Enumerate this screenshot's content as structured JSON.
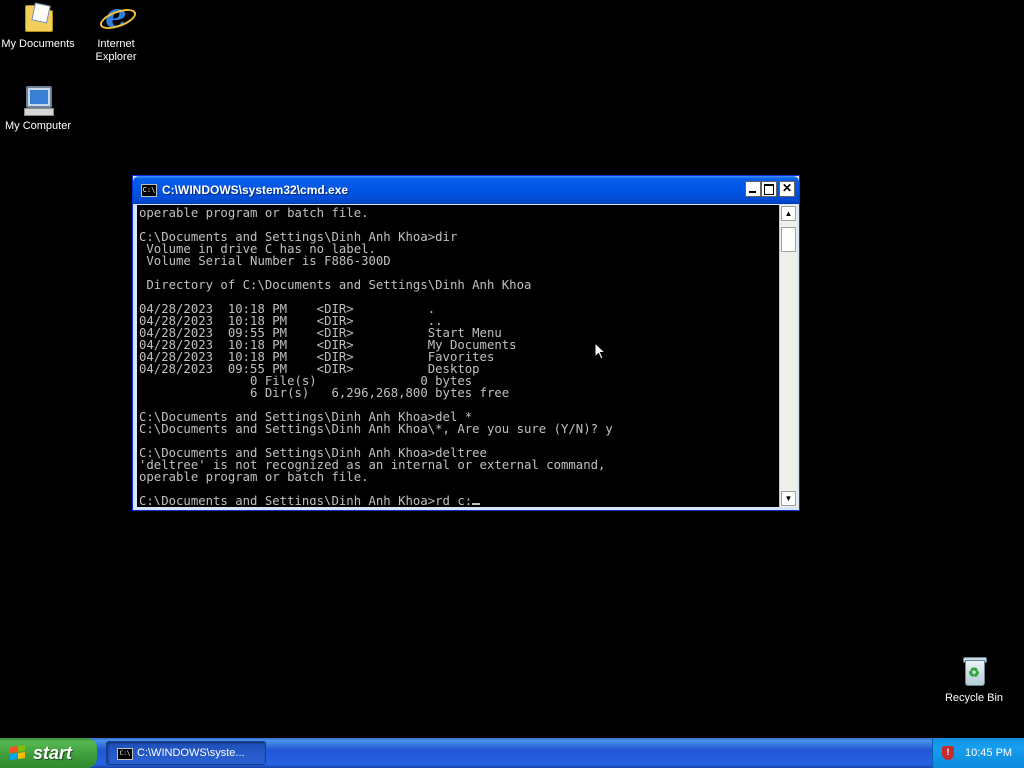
{
  "desktop": {
    "icons": [
      {
        "label": "My Documents"
      },
      {
        "label": "Internet Explorer"
      },
      {
        "label": "My Computer"
      },
      {
        "label": "Recycle Bin"
      }
    ]
  },
  "window": {
    "title": "C:\\WINDOWS\\system32\\cmd.exe",
    "console_lines": [
      "operable program or batch file.",
      "",
      "C:\\Documents and Settings\\Dinh Anh Khoa>dir",
      " Volume in drive C has no label.",
      " Volume Serial Number is F886-300D",
      "",
      " Directory of C:\\Documents and Settings\\Dinh Anh Khoa",
      "",
      "04/28/2023  10:18 PM    <DIR>          .",
      "04/28/2023  10:18 PM    <DIR>          ..",
      "04/28/2023  09:55 PM    <DIR>          Start Menu",
      "04/28/2023  10:18 PM    <DIR>          My Documents",
      "04/28/2023  10:18 PM    <DIR>          Favorites",
      "04/28/2023  09:55 PM    <DIR>          Desktop",
      "               0 File(s)              0 bytes",
      "               6 Dir(s)   6,296,268,800 bytes free",
      "",
      "C:\\Documents and Settings\\Dinh Anh Khoa>del *",
      "C:\\Documents and Settings\\Dinh Anh Khoa\\*, Are you sure (Y/N)? y",
      "",
      "C:\\Documents and Settings\\Dinh Anh Khoa>deltree",
      "'deltree' is not recognized as an internal or external command,",
      "operable program or batch file.",
      "",
      "C:\\Documents and Settings\\Dinh Anh Khoa>rd c:"
    ],
    "app_icon_text": "C:\\",
    "buttons": {
      "minimize": "minimize-icon",
      "maximize": "maximize-icon",
      "close": "close-icon"
    },
    "close_glyph": "✕",
    "scroll_up_glyph": "▲",
    "scroll_down_glyph": "▼"
  },
  "taskbar": {
    "start_label": "start",
    "task_label": "C:\\WINDOWS\\syste...",
    "task_icon_text": "C:\\",
    "clock": "10:45 PM",
    "tray_icon": "security-shield-icon",
    "shield_glyph": "!"
  },
  "colors": {
    "desktop_bg": "#000000",
    "console_text": "#c0c0c0",
    "titlebar": "#0055e5",
    "taskbar": "#2157d7",
    "start_button": "#3e9e3c"
  }
}
